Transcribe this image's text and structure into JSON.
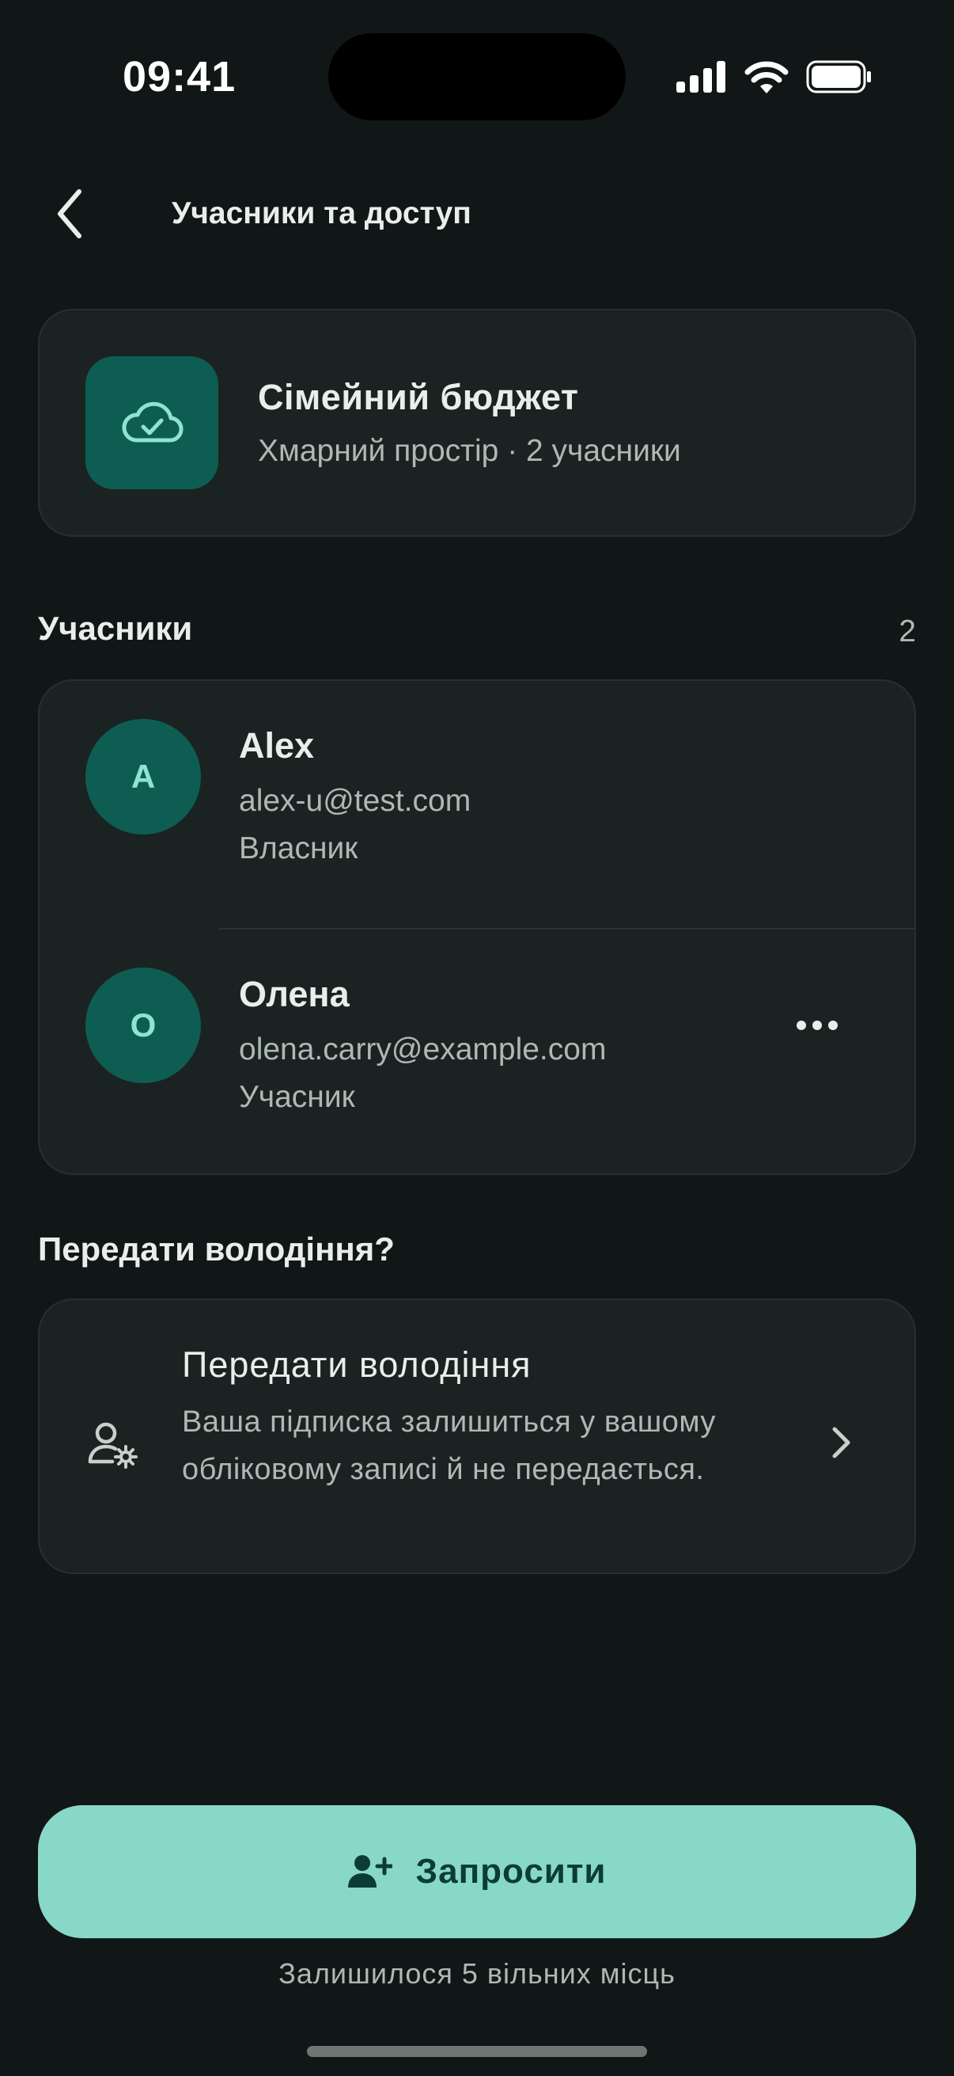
{
  "status_bar": {
    "time": "09:41"
  },
  "header": {
    "title": "Учасники та доступ"
  },
  "space": {
    "name": "Сімейний бюджет",
    "meta": "Хмарний простір · 2 учасники",
    "icon": "cloud-check-icon"
  },
  "members_section": {
    "title": "Учасники",
    "count": "2"
  },
  "members": [
    {
      "initial": "A",
      "name": "Alex",
      "email": "alex-u@test.com",
      "role": "Власник"
    },
    {
      "initial": "О",
      "name": "Олена",
      "email": "olena.carry@example.com",
      "role": "Учасник"
    }
  ],
  "transfer_section": {
    "title": "Передати володіння?",
    "card_title": "Передати володіння",
    "card_desc": "Ваша підписка залишиться у вашому обліковому записі й не передається.",
    "icon": "user-gear-icon"
  },
  "invite": {
    "label": "Запросити",
    "icon": "add-user-icon",
    "seats_left": "Залишилося 5 вільних місць"
  },
  "colors": {
    "background": "#111716",
    "card": "#1b2322",
    "accent": "#88d8c9",
    "avatar": "#0e5d53"
  }
}
